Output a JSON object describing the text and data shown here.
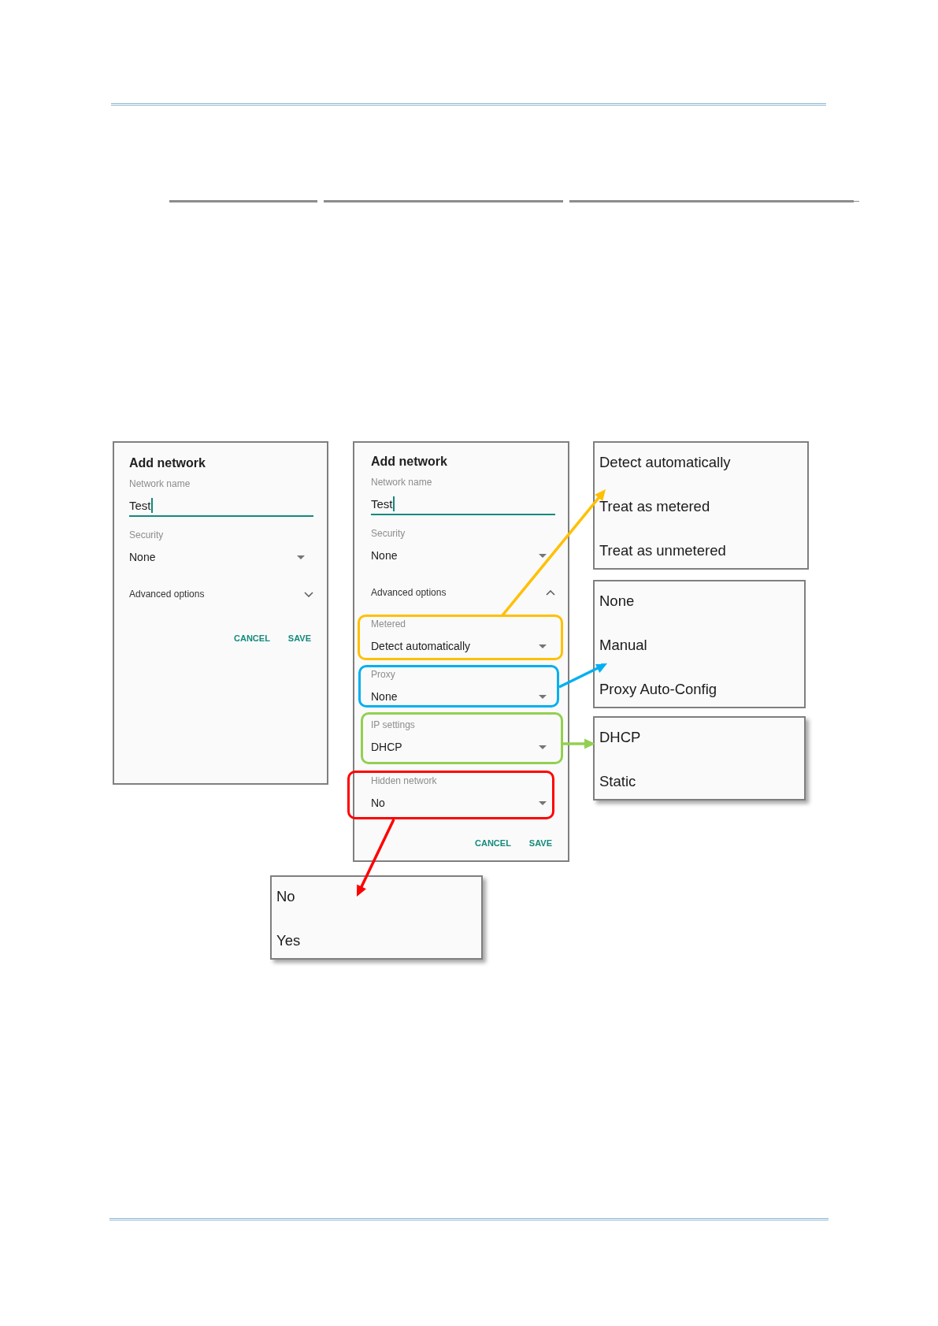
{
  "dialogs": [
    {
      "title": "Add network",
      "fields": [
        {
          "kind": "text",
          "label": "Network name",
          "value": "Test",
          "focused": true
        },
        {
          "kind": "dropdown",
          "label": "Security",
          "value": "None"
        }
      ],
      "advanced": {
        "label": "Advanced options",
        "expanded": false
      },
      "buttons": [
        "CANCEL",
        "SAVE"
      ]
    },
    {
      "title": "Add network",
      "fields": [
        {
          "kind": "text",
          "label": "Network name",
          "value": "Test",
          "focused": true
        },
        {
          "kind": "dropdown",
          "label": "Security",
          "value": "None"
        }
      ],
      "advanced": {
        "label": "Advanced options",
        "expanded": true,
        "fields": [
          {
            "label": "Metered",
            "value": "Detect automatically",
            "color": "#ffc000"
          },
          {
            "label": "Proxy",
            "value": "None",
            "color": "#00b0f0"
          },
          {
            "label": "IP settings",
            "value": "DHCP",
            "color": "#92d050"
          },
          {
            "label": "Hidden network",
            "value": "No",
            "color": "#ff0000"
          }
        ]
      },
      "buttons": [
        "CANCEL",
        "SAVE"
      ]
    }
  ],
  "option_lists": [
    {
      "options": [
        "Detect automatically",
        "Treat as metered",
        "Treat as unmetered"
      ]
    },
    {
      "options": [
        "None",
        "Manual",
        "Proxy Auto-Config"
      ]
    },
    {
      "options": [
        "DHCP",
        "Static"
      ]
    },
    {
      "options": [
        "No",
        "Yes"
      ]
    }
  ]
}
